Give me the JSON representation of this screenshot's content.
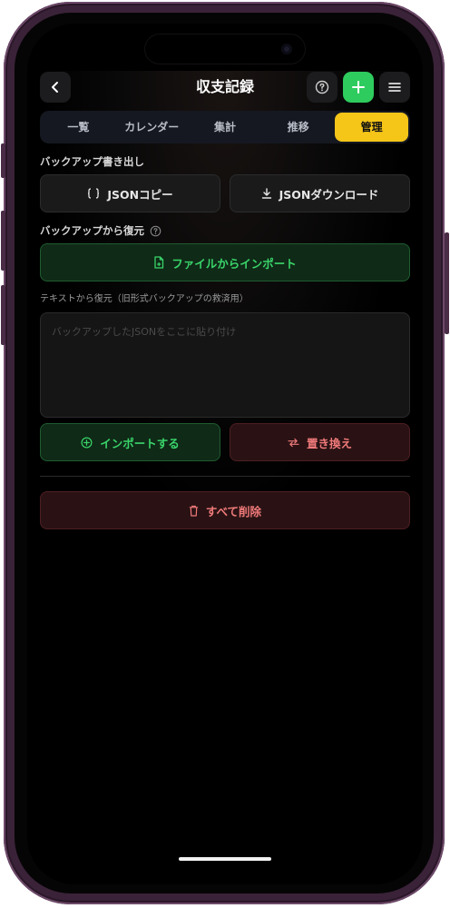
{
  "header": {
    "title": "収支記録",
    "back_icon": "chevron-left-icon",
    "help_icon": "question-circle-icon",
    "add_icon": "plus-icon",
    "menu_icon": "hamburger-menu-icon"
  },
  "tabs": [
    {
      "label": "一覧",
      "active": false
    },
    {
      "label": "カレンダー",
      "active": false
    },
    {
      "label": "集計",
      "active": false
    },
    {
      "label": "推移",
      "active": false
    },
    {
      "label": "管理",
      "active": true
    }
  ],
  "backup_export": {
    "label": "バックアップ書き出し",
    "copy_json_label": "JSONコピー",
    "download_json_label": "JSONダウンロード"
  },
  "restore": {
    "label": "バックアップから復元",
    "import_file_label": "ファイルからインポート"
  },
  "text_restore": {
    "label": "テキストから復元（旧形式バックアップの救済用）",
    "placeholder": "バックアップしたJSONをここに貼り付け",
    "import_label": "インポートする",
    "replace_label": "置き換え"
  },
  "danger": {
    "delete_all_label": "すべて削除"
  },
  "colors": {
    "accent": "#f5c518",
    "add_button": "#2ecc5e",
    "green_text": "#3ad46a",
    "red_text": "#f07a7a"
  }
}
